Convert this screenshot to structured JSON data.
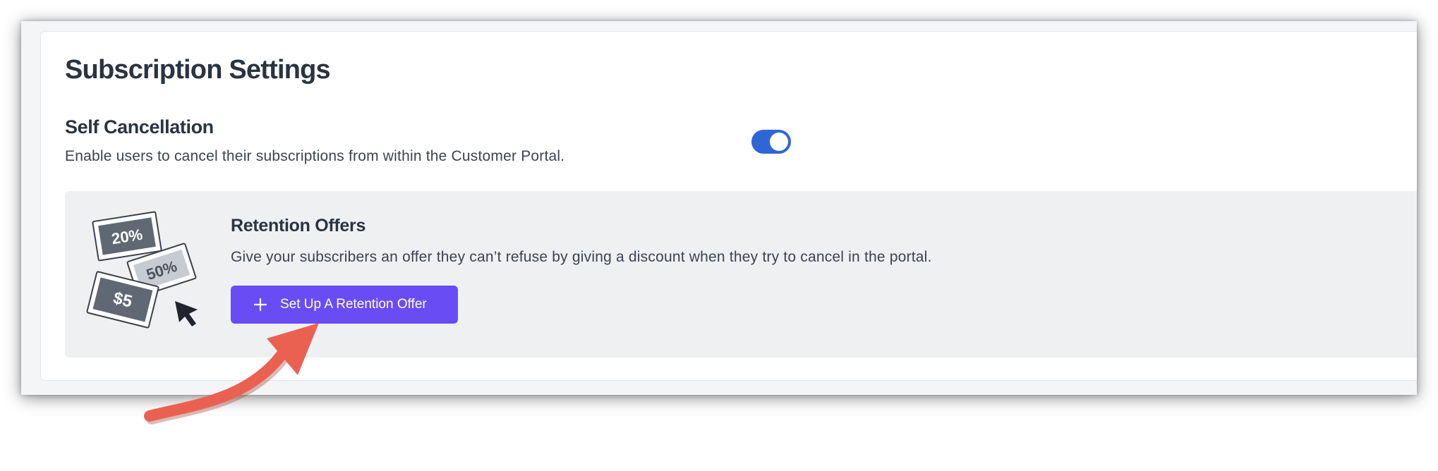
{
  "page": {
    "title": "Subscription Settings"
  },
  "self_cancellation": {
    "title": "Self Cancellation",
    "description": "Enable users to cancel their subscriptions from within the Customer Portal.",
    "toggle_on": true
  },
  "retention": {
    "title": "Retention Offers",
    "description": "Give your subscribers an offer they can’t refuse by giving a discount when they try to cancel in the portal.",
    "button_label": "Set Up A Retention Offer",
    "coupons": [
      "20%",
      "50%",
      "$5"
    ]
  },
  "colors": {
    "toggle": "#2f66d6",
    "button": "#6a4cf5",
    "arrow": "#ea6152"
  },
  "icons": [
    "coupon-illustration-icon",
    "cursor-icon",
    "plus-icon",
    "annotation-arrow-icon"
  ]
}
